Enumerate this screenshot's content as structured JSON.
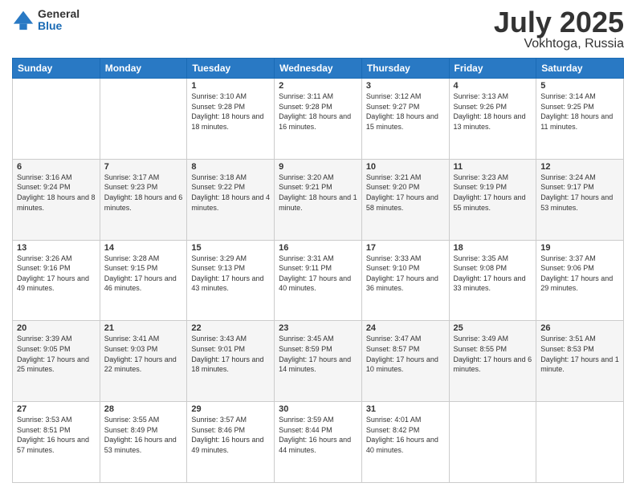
{
  "logo": {
    "general": "General",
    "blue": "Blue"
  },
  "title": {
    "month": "July 2025",
    "location": "Vokhtoga, Russia"
  },
  "weekdays": [
    "Sunday",
    "Monday",
    "Tuesday",
    "Wednesday",
    "Thursday",
    "Friday",
    "Saturday"
  ],
  "weeks": [
    [
      {
        "day": "",
        "info": ""
      },
      {
        "day": "",
        "info": ""
      },
      {
        "day": "1",
        "info": "Sunrise: 3:10 AM\nSunset: 9:28 PM\nDaylight: 18 hours and 18 minutes."
      },
      {
        "day": "2",
        "info": "Sunrise: 3:11 AM\nSunset: 9:28 PM\nDaylight: 18 hours and 16 minutes."
      },
      {
        "day": "3",
        "info": "Sunrise: 3:12 AM\nSunset: 9:27 PM\nDaylight: 18 hours and 15 minutes."
      },
      {
        "day": "4",
        "info": "Sunrise: 3:13 AM\nSunset: 9:26 PM\nDaylight: 18 hours and 13 minutes."
      },
      {
        "day": "5",
        "info": "Sunrise: 3:14 AM\nSunset: 9:25 PM\nDaylight: 18 hours and 11 minutes."
      }
    ],
    [
      {
        "day": "6",
        "info": "Sunrise: 3:16 AM\nSunset: 9:24 PM\nDaylight: 18 hours and 8 minutes."
      },
      {
        "day": "7",
        "info": "Sunrise: 3:17 AM\nSunset: 9:23 PM\nDaylight: 18 hours and 6 minutes."
      },
      {
        "day": "8",
        "info": "Sunrise: 3:18 AM\nSunset: 9:22 PM\nDaylight: 18 hours and 4 minutes."
      },
      {
        "day": "9",
        "info": "Sunrise: 3:20 AM\nSunset: 9:21 PM\nDaylight: 18 hours and 1 minute."
      },
      {
        "day": "10",
        "info": "Sunrise: 3:21 AM\nSunset: 9:20 PM\nDaylight: 17 hours and 58 minutes."
      },
      {
        "day": "11",
        "info": "Sunrise: 3:23 AM\nSunset: 9:19 PM\nDaylight: 17 hours and 55 minutes."
      },
      {
        "day": "12",
        "info": "Sunrise: 3:24 AM\nSunset: 9:17 PM\nDaylight: 17 hours and 53 minutes."
      }
    ],
    [
      {
        "day": "13",
        "info": "Sunrise: 3:26 AM\nSunset: 9:16 PM\nDaylight: 17 hours and 49 minutes."
      },
      {
        "day": "14",
        "info": "Sunrise: 3:28 AM\nSunset: 9:15 PM\nDaylight: 17 hours and 46 minutes."
      },
      {
        "day": "15",
        "info": "Sunrise: 3:29 AM\nSunset: 9:13 PM\nDaylight: 17 hours and 43 minutes."
      },
      {
        "day": "16",
        "info": "Sunrise: 3:31 AM\nSunset: 9:11 PM\nDaylight: 17 hours and 40 minutes."
      },
      {
        "day": "17",
        "info": "Sunrise: 3:33 AM\nSunset: 9:10 PM\nDaylight: 17 hours and 36 minutes."
      },
      {
        "day": "18",
        "info": "Sunrise: 3:35 AM\nSunset: 9:08 PM\nDaylight: 17 hours and 33 minutes."
      },
      {
        "day": "19",
        "info": "Sunrise: 3:37 AM\nSunset: 9:06 PM\nDaylight: 17 hours and 29 minutes."
      }
    ],
    [
      {
        "day": "20",
        "info": "Sunrise: 3:39 AM\nSunset: 9:05 PM\nDaylight: 17 hours and 25 minutes."
      },
      {
        "day": "21",
        "info": "Sunrise: 3:41 AM\nSunset: 9:03 PM\nDaylight: 17 hours and 22 minutes."
      },
      {
        "day": "22",
        "info": "Sunrise: 3:43 AM\nSunset: 9:01 PM\nDaylight: 17 hours and 18 minutes."
      },
      {
        "day": "23",
        "info": "Sunrise: 3:45 AM\nSunset: 8:59 PM\nDaylight: 17 hours and 14 minutes."
      },
      {
        "day": "24",
        "info": "Sunrise: 3:47 AM\nSunset: 8:57 PM\nDaylight: 17 hours and 10 minutes."
      },
      {
        "day": "25",
        "info": "Sunrise: 3:49 AM\nSunset: 8:55 PM\nDaylight: 17 hours and 6 minutes."
      },
      {
        "day": "26",
        "info": "Sunrise: 3:51 AM\nSunset: 8:53 PM\nDaylight: 17 hours and 1 minute."
      }
    ],
    [
      {
        "day": "27",
        "info": "Sunrise: 3:53 AM\nSunset: 8:51 PM\nDaylight: 16 hours and 57 minutes."
      },
      {
        "day": "28",
        "info": "Sunrise: 3:55 AM\nSunset: 8:49 PM\nDaylight: 16 hours and 53 minutes."
      },
      {
        "day": "29",
        "info": "Sunrise: 3:57 AM\nSunset: 8:46 PM\nDaylight: 16 hours and 49 minutes."
      },
      {
        "day": "30",
        "info": "Sunrise: 3:59 AM\nSunset: 8:44 PM\nDaylight: 16 hours and 44 minutes."
      },
      {
        "day": "31",
        "info": "Sunrise: 4:01 AM\nSunset: 8:42 PM\nDaylight: 16 hours and 40 minutes."
      },
      {
        "day": "",
        "info": ""
      },
      {
        "day": "",
        "info": ""
      }
    ]
  ]
}
